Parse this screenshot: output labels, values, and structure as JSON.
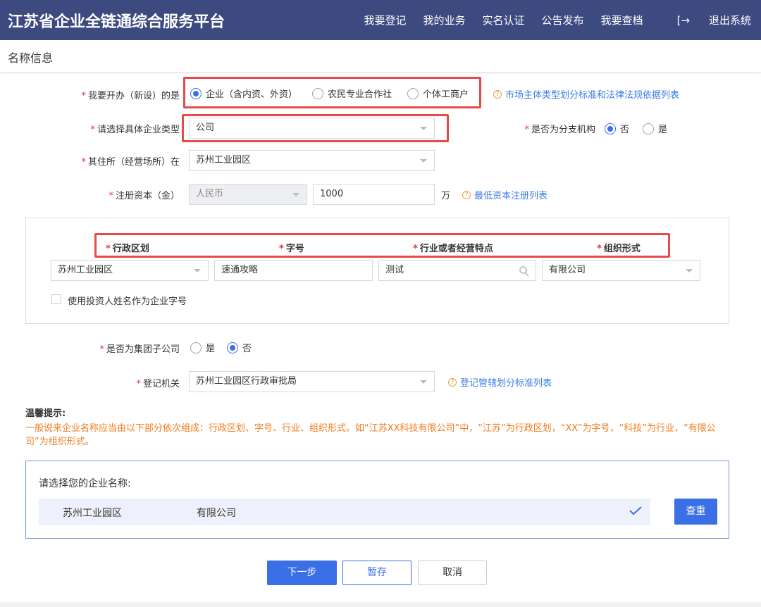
{
  "header": {
    "brand": "江苏省企业全链通综合服务平台",
    "nav": [
      "我要登记",
      "我的业务",
      "实名认证",
      "公告发布",
      "我要查档"
    ],
    "logout": "退出系统"
  },
  "section_title": "名称信息",
  "form": {
    "entity_type": {
      "label": "我要开办（新设）的是",
      "options": [
        "企业（含内资、外资）",
        "农民专业合作社",
        "个体工商户"
      ],
      "selected": 0,
      "help": "市场主体类型划分标准和法律法规依据列表"
    },
    "company_type": {
      "label": "请选择具体企业类型",
      "value": "公司"
    },
    "branch": {
      "label": "是否为分支机构",
      "options": [
        "否",
        "是"
      ],
      "selected": 0
    },
    "location": {
      "label": "其住所（经营场所）在",
      "value": "苏州工业园区"
    },
    "capital": {
      "label": "注册资本（金）",
      "currency": "人民币",
      "amount": "1000",
      "unit": "万",
      "help": "最低资本注册列表"
    },
    "name_parts": {
      "headers": [
        "行政区划",
        "字号",
        "行业或者经营特点",
        "组织形式"
      ],
      "district": "苏州工业园区",
      "trade_name": "速通攻略",
      "industry": "测试",
      "org_form": "有限公司",
      "use_investor_name": "使用投资人姓名作为企业字号"
    },
    "group_sub": {
      "label": "是否为集团子公司",
      "options": [
        "是",
        "否"
      ],
      "selected": 1
    },
    "authority": {
      "label": "登记机关",
      "value": "苏州工业园区行政审批局",
      "help": "登记管辖划分标准列表"
    }
  },
  "tips": {
    "title": "温馨提示:",
    "body": "一般说来企业名称应当由以下部分依次组成：行政区划、字号、行业、组织形式。如“江苏XX科技有限公司”中，“江苏”为行政区划，“XX”为字号，“科技”为行业，“有限公司”为组织形式。"
  },
  "choose": {
    "title": "请选择您的企业名称:",
    "name_left": "苏州工业园区",
    "name_right": "有限公司",
    "check_button": "查重"
  },
  "actions": {
    "next": "下一步",
    "save": "暂存",
    "cancel": "取消"
  },
  "colors": {
    "header_bg": "#3c4a80",
    "accent": "#3a6fe6",
    "tip": "#f07c1f",
    "highlight": "#e64a4a"
  }
}
